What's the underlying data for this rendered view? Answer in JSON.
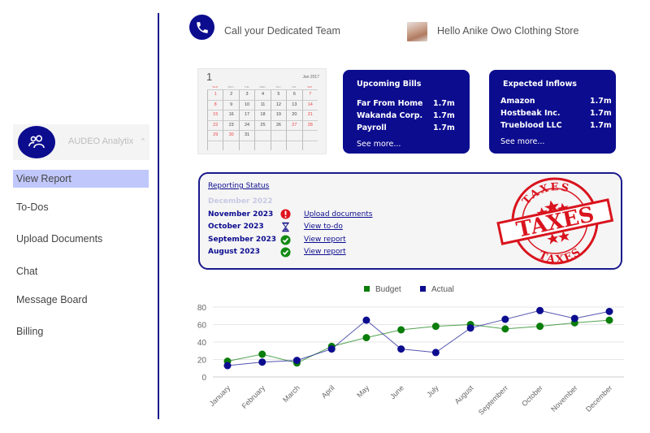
{
  "sidebar": {
    "brand_name": "AUDEO Analytix",
    "brand_icon": "users-icon",
    "items": [
      {
        "label": "View Report",
        "active": true
      },
      {
        "label": "To-Dos",
        "active": false
      },
      {
        "label": "Upload Documents",
        "active": false
      },
      {
        "label": "Chat",
        "active": false
      },
      {
        "label": "Message Board",
        "active": false
      },
      {
        "label": "Billing",
        "active": false
      }
    ]
  },
  "header": {
    "call_label": "Call your Dedicated Team",
    "call_icon": "phone-icon",
    "greeting": "Hello Anike Owo Clothing Store"
  },
  "calendar": {
    "month_number": "1",
    "month_label": "Jan 2017",
    "weekdays": [
      "SUN",
      "MON",
      "TUE",
      "WED",
      "THU",
      "FRI",
      "SAT"
    ],
    "days": [
      "1",
      "2",
      "3",
      "4",
      "5",
      "6",
      "7",
      "8",
      "9",
      "10",
      "11",
      "12",
      "13",
      "14",
      "15",
      "16",
      "17",
      "18",
      "19",
      "20",
      "21",
      "22",
      "23",
      "24",
      "25",
      "26",
      "27",
      "28",
      "29",
      "30",
      "31"
    ]
  },
  "upcoming_bills": {
    "title": "Upcoming Bills",
    "rows": [
      {
        "name": "Far From Home",
        "amount": "1.7m"
      },
      {
        "name": "Wakanda Corp.",
        "amount": "1.7m"
      },
      {
        "name": "Payroll",
        "amount": "1.7m"
      }
    ],
    "see_more": "See more..."
  },
  "expected_inflows": {
    "title": "Expected Inflows",
    "rows": [
      {
        "name": "Amazon",
        "amount": "1.7m"
      },
      {
        "name": "Hostbeak Inc.",
        "amount": "1.7m"
      },
      {
        "name": "Trueblood LLC",
        "amount": "1.7m"
      }
    ],
    "see_more": "See more..."
  },
  "reporting_status": {
    "title": "Reporting Status",
    "rows": [
      {
        "month": "December 2022",
        "status": "none",
        "action": ""
      },
      {
        "month": "November 2023",
        "status": "alert",
        "action": "Upload documents"
      },
      {
        "month": "October 2023",
        "status": "pending",
        "action": "View to-do"
      },
      {
        "month": "September 2023",
        "status": "complete",
        "action": "View report"
      },
      {
        "month": "August 2023",
        "status": "complete",
        "action": "View report"
      }
    ],
    "stamp": {
      "main": "TAXES",
      "top": "TAXES",
      "bottom": "TAXES",
      "color": "#d9141e"
    }
  },
  "colors": {
    "primary": "#0c0c8f",
    "active_nav": "#c0c8fb",
    "budget": "#0a7d0a",
    "actual": "#0c0c8f"
  },
  "chart_data": {
    "type": "line",
    "title": "",
    "xlabel": "",
    "ylabel": "",
    "categories": [
      "January",
      "February",
      "March",
      "April",
      "May",
      "June",
      "July",
      "August",
      "Septemberr",
      "October",
      "November",
      "December"
    ],
    "series": [
      {
        "name": "Budget",
        "color": "#0a7d0a",
        "values": [
          18,
          26,
          16,
          35,
          45,
          54,
          58,
          60,
          55,
          58,
          62,
          65
        ]
      },
      {
        "name": "Actual",
        "color": "#0c0c8f",
        "values": [
          13,
          17,
          19,
          32,
          65,
          32,
          28,
          56,
          66,
          76,
          67,
          75
        ]
      }
    ],
    "yticks": [
      0,
      20,
      40,
      60,
      80
    ],
    "ylim": [
      0,
      80
    ],
    "grid": true,
    "legend": "top-center"
  }
}
